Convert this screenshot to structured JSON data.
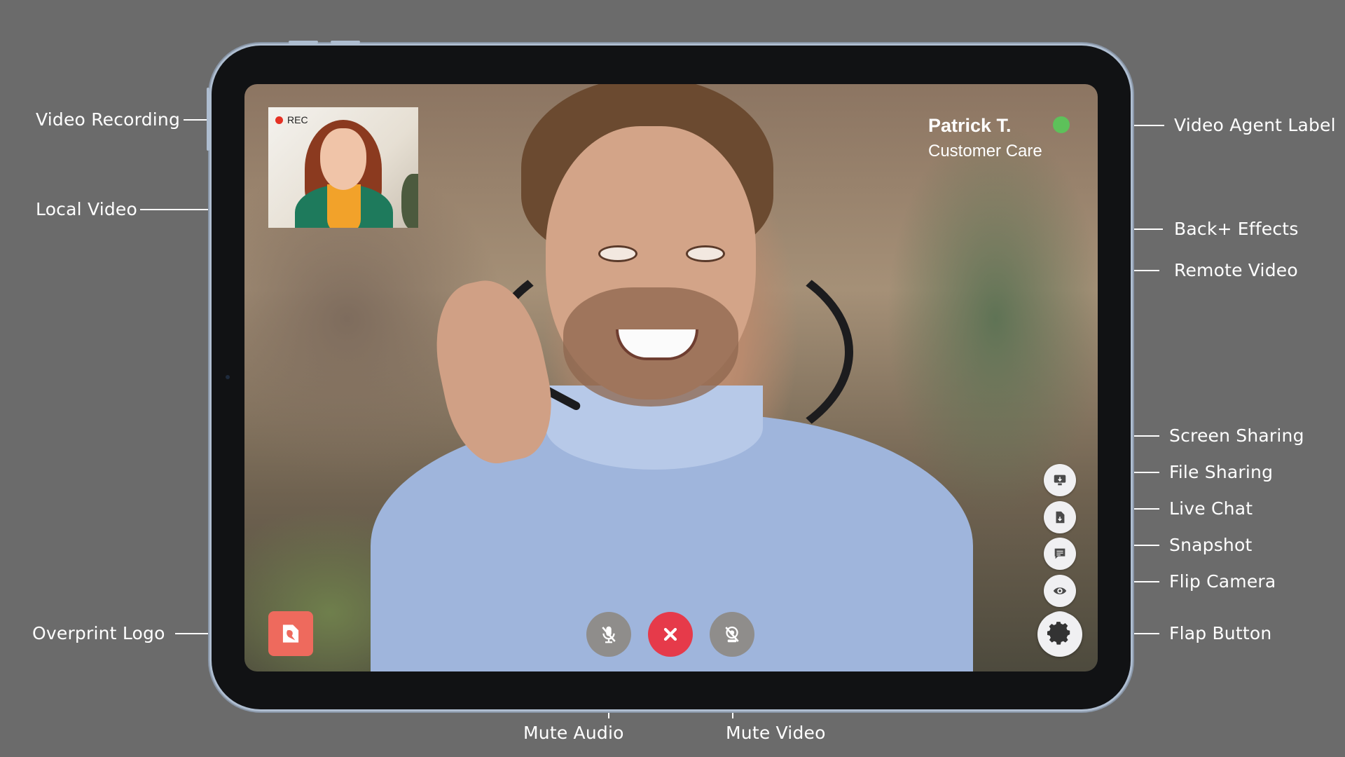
{
  "annotations": {
    "video_recording": "Video Recording",
    "local_video": "Local Video",
    "overprint_logo": "Overprint Logo",
    "video_agent_label": "Video Agent Label",
    "back_effects": "Back+ Effects",
    "remote_video": "Remote Video",
    "screen_sharing": "Screen Sharing",
    "file_sharing": "File Sharing",
    "live_chat": "Live Chat",
    "snapshot": "Snapshot",
    "flip_camera": "Flip Camera",
    "flap_button": "Flap Button",
    "mute_audio": "Mute Audio",
    "mute_video": "Mute Video"
  },
  "screen": {
    "rec_label": "REC",
    "agent": {
      "name": "Patrick T.",
      "role": "Customer Care",
      "status_color": "#5dc15a"
    },
    "side_buttons": [
      {
        "icon": "screen-share-icon"
      },
      {
        "icon": "file-icon"
      },
      {
        "icon": "chat-icon"
      },
      {
        "icon": "eye-icon"
      },
      {
        "icon": "flip-camera-icon"
      }
    ],
    "flap_icon": "gear-icon",
    "controls": {
      "mute_audio_icon": "microphone-mute-icon",
      "end_call_icon": "close-icon",
      "mute_video_icon": "camera-mute-icon",
      "end_call_color": "#e63a4a"
    },
    "logo_color": "#ee6a5d"
  }
}
